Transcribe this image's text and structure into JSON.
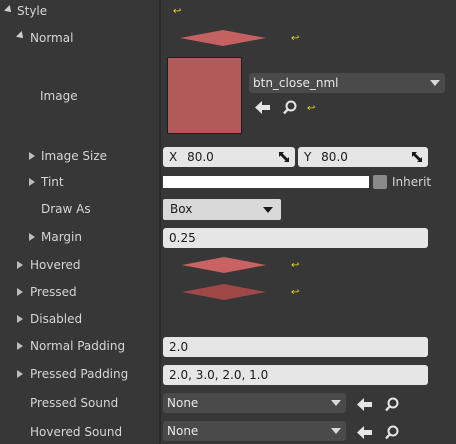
{
  "rows": {
    "style": "Style",
    "normal": "Normal",
    "image": "Image",
    "image_size": "Image Size",
    "tint": "Tint",
    "draw_as": "Draw As",
    "margin": "Margin",
    "hovered": "Hovered",
    "pressed": "Pressed",
    "disabled": "Disabled",
    "normal_padding": "Normal Padding",
    "pressed_padding": "Pressed Padding",
    "pressed_sound": "Pressed Sound",
    "hovered_sound": "Hovered Sound"
  },
  "values": {
    "image_asset": "btn_close_nml",
    "size_x_label": "X",
    "size_x": "80.0",
    "size_y_label": "Y",
    "size_y": "80.0",
    "tint_inherit": "Inherit",
    "draw_as": "Box",
    "margin": "0.25",
    "normal_padding": "2.0",
    "pressed_padding": "2.0, 3.0, 2.0, 1.0",
    "pressed_sound": "None",
    "hovered_sound": "None"
  },
  "colors": {
    "swatch": "#b15a5a",
    "diamond_normal": "#c46161",
    "diamond_hovered": "#c96262",
    "diamond_pressed": "#9f4848",
    "reset_yellow": "#e8d12b"
  },
  "icons": [
    "collapse-arrow-icon",
    "expand-arrow-icon",
    "reset-to-default-icon",
    "use-selected-arrow-icon",
    "browse-search-icon",
    "expand-corner-icon",
    "dropdown-caret-icon"
  ]
}
